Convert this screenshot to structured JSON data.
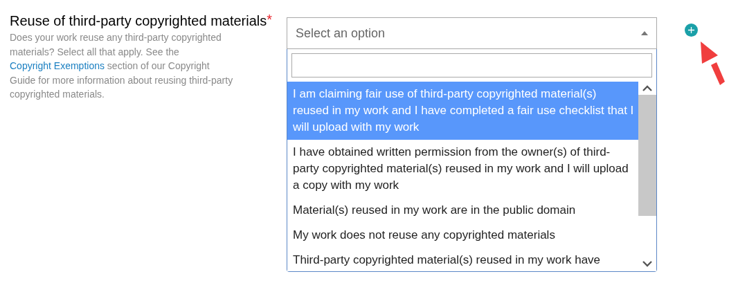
{
  "field": {
    "label": "Reuse of third-party copyrighted materials",
    "required_mark": "*",
    "help_before": "Does your work reuse any third-party copyrighted materials? Select all that apply. See the",
    "help_link": "Copyright Exemptions",
    "help_after": "section of our Copyright Guide for more information about reusing third-party copyrighted materials."
  },
  "select": {
    "placeholder": "Select an option",
    "expanded": true,
    "options": [
      {
        "label": "I am claiming fair use of third-party copyrighted material(s) reused in my work and I have completed a fair use checklist that I will upload with my work",
        "selected": true
      },
      {
        "label": "I have obtained written permission from the owner(s) of third-party copyrighted material(s) reused in my work and I will upload a copy with my work",
        "selected": false
      },
      {
        "label": "Material(s) reused in my work are in the public domain",
        "selected": false
      },
      {
        "label": "My work does not reuse any copyrighted materials",
        "selected": false
      },
      {
        "label": "Third-party copyrighted material(s) reused in my work have",
        "selected": false
      }
    ]
  }
}
